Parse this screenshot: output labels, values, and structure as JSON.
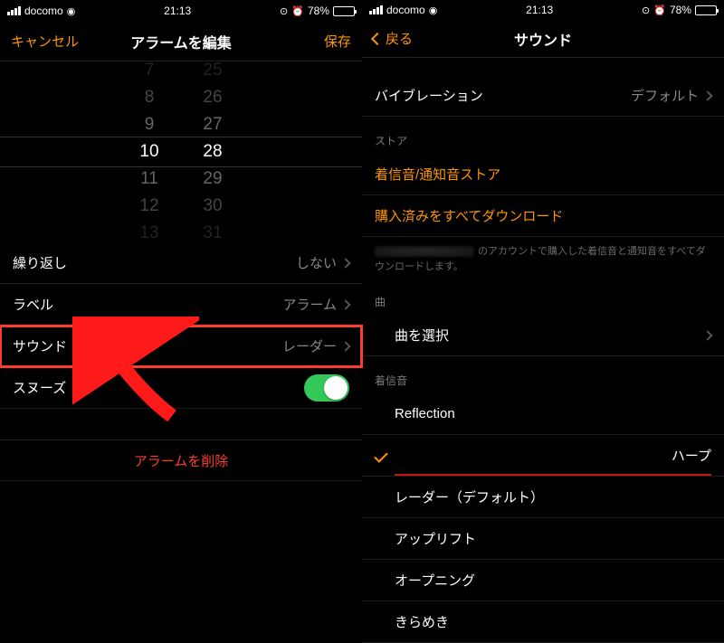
{
  "status": {
    "carrier": "docomo",
    "time": "21:13",
    "battery_pct": "78%"
  },
  "left": {
    "nav": {
      "cancel": "キャンセル",
      "title": "アラームを編集",
      "save": "保存"
    },
    "picker": {
      "hours": [
        "7",
        "8",
        "9",
        "10",
        "11",
        "12",
        "13"
      ],
      "minutes": [
        "25",
        "26",
        "27",
        "28",
        "29",
        "30",
        "31"
      ]
    },
    "rows": {
      "repeat": {
        "label": "繰り返し",
        "value": "しない"
      },
      "label": {
        "label": "ラベル",
        "value": "アラーム"
      },
      "sound": {
        "label": "サウンド",
        "value": "レーダー"
      },
      "snooze": {
        "label": "スヌーズ"
      }
    },
    "delete": "アラームを削除"
  },
  "right": {
    "nav": {
      "back": "戻る",
      "title": "サウンド"
    },
    "vibration": {
      "label": "バイブレーション",
      "value": "デフォルト"
    },
    "sections": {
      "store": "ストア",
      "song": "曲",
      "ringtone": "着信音"
    },
    "store": {
      "tone_store": "着信音/通知音ストア",
      "download_all": "購入済みをすべてダウンロード",
      "footer": "のアカウントで購入した着信音と通知音をすべてダウンロードします。"
    },
    "song": {
      "pick": "曲を選択"
    },
    "ringtones": [
      "Reflection",
      "ハープ",
      "レーダー（デフォルト）",
      "アップリフト",
      "オープニング",
      "きらめき"
    ]
  }
}
